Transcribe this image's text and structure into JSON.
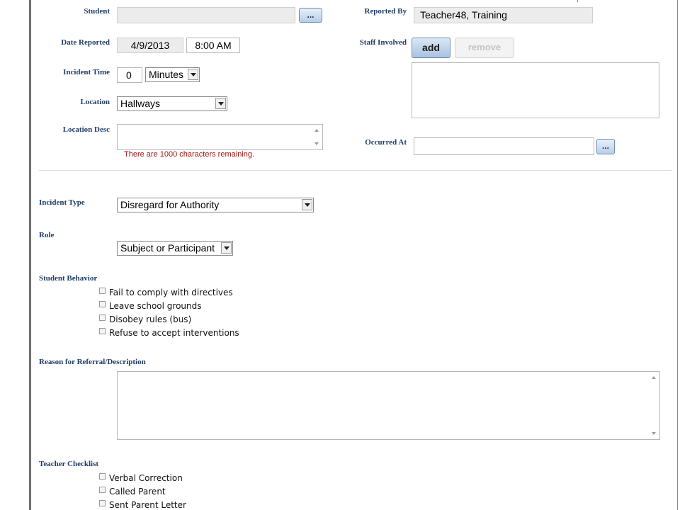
{
  "form": {
    "student": {
      "label": "Student",
      "value": "",
      "lookup_label": "..."
    },
    "reported_by": {
      "label": "Reported By",
      "value": "Teacher48, Training"
    },
    "date_reported": {
      "label": "Date Reported",
      "date": "4/9/2013",
      "time": "8:00 AM"
    },
    "staff_involved": {
      "label": "Staff Involved",
      "add_label": "add",
      "remove_label": "remove"
    },
    "incident_time": {
      "label": "Incident Time",
      "value": "0",
      "unit": "Minutes"
    },
    "location": {
      "label": "Location",
      "value": "Hallways"
    },
    "location_desc": {
      "label": "Location Desc",
      "remaining": "There are 1000 characters remaining."
    },
    "occurred_at": {
      "label": "Occurred At",
      "value": "",
      "lookup_label": "..."
    },
    "incident_type": {
      "label": "Incident Type",
      "value": "Disregard for Authority"
    },
    "role": {
      "label": "Role",
      "value": "Subject or Participant"
    },
    "student_behavior": {
      "label": "Student Behavior",
      "items": [
        "Fail to comply with directives",
        "Leave school grounds",
        "Disobey rules (bus)",
        "Refuse to accept interventions"
      ]
    },
    "reason": {
      "label": "Reason for Referral/Description"
    },
    "teacher_checklist": {
      "label": "Teacher Checklist",
      "items": [
        "Verbal Correction",
        "Called Parent",
        "Sent Parent Letter"
      ]
    }
  },
  "colors": {
    "label": "#1f3d66",
    "hint": "#a31515",
    "button_accent": "#6b8bb5"
  }
}
